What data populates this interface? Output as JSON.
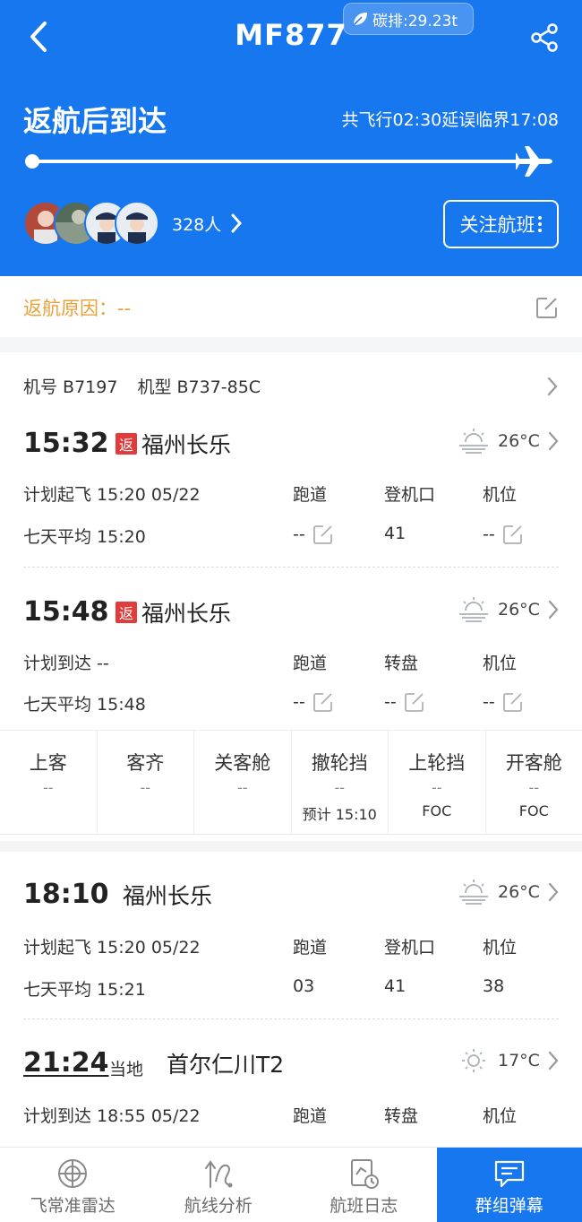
{
  "header": {
    "flight_no": "MF877",
    "carbon": "碳排:29.23t",
    "status": "返航后到达",
    "meta": "共飞行02:30延误临界17:08",
    "followers": "328人",
    "follow_button": "关注航班",
    "progress_fraction": 1.0
  },
  "reason": {
    "label": "返航原因：--"
  },
  "aircraft": {
    "reg": "机号 B7197",
    "type": "机型 B737-85C"
  },
  "segments": [
    {
      "time": "15:32",
      "tag": "返",
      "airport": "福州长乐",
      "temp": "26°C",
      "weather_icon": "hazy-sun-icon",
      "labels": [
        "计划起飞 15:20 05/22",
        "跑道",
        "登机口",
        "机位"
      ],
      "values": [
        "七天平均 15:20",
        "--",
        "41",
        "--"
      ]
    },
    {
      "time": "15:48",
      "tag": "返",
      "airport": "福州长乐",
      "temp": "26°C",
      "weather_icon": "hazy-sun-icon",
      "labels": [
        "计划到达 --",
        "跑道",
        "转盘",
        "机位"
      ],
      "values": [
        "七天平均 15:48",
        "--",
        "--",
        "--"
      ]
    },
    {
      "time": "18:10",
      "airport": "福州长乐",
      "temp": "26°C",
      "weather_icon": "hazy-sun-icon",
      "labels": [
        "计划起飞 15:20 05/22",
        "跑道",
        "登机口",
        "机位"
      ],
      "values": [
        "七天平均 15:21",
        "03",
        "41",
        "38"
      ]
    },
    {
      "time": "21:24",
      "local": "当地",
      "airport": "首尔仁川T2",
      "temp": "17°C",
      "weather_icon": "sun-icon",
      "labels": [
        "计划到达 18:55 05/22",
        "跑道",
        "转盘",
        "机位"
      ]
    }
  ],
  "ground": [
    {
      "title": "上客",
      "value": "--",
      "sub": ""
    },
    {
      "title": "客齐",
      "value": "--",
      "sub": ""
    },
    {
      "title": "关客舱",
      "value": "--",
      "sub": ""
    },
    {
      "title": "撤轮挡",
      "value": "--",
      "sub": "预计 15:10"
    },
    {
      "title": "上轮挡",
      "value": "--",
      "sub": "FOC"
    },
    {
      "title": "开客舱",
      "value": "--",
      "sub": "FOC"
    }
  ],
  "nav": [
    {
      "label": "飞常准雷达",
      "icon": "radar-icon"
    },
    {
      "label": "航线分析",
      "icon": "route-icon"
    },
    {
      "label": "航班日志",
      "icon": "log-icon"
    },
    {
      "label": "群组弹幕",
      "icon": "chat-icon"
    }
  ],
  "colors": {
    "primary": "#1677ee",
    "warning": "#e8a13a",
    "return_tag": "#e23b3b"
  }
}
